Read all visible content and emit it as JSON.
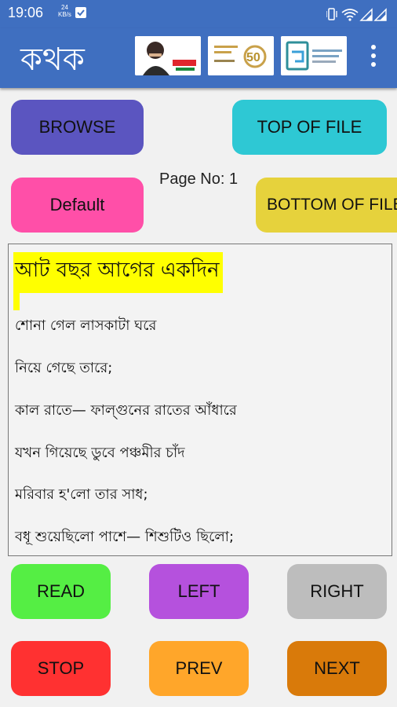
{
  "status_bar": {
    "time": "19:06",
    "network": "24 KB/s",
    "icons": [
      "notification-check-icon",
      "vibrate-icon",
      "wifi-icon",
      "signal-icon",
      "signal-2-icon"
    ]
  },
  "app_bar": {
    "title": "কথক",
    "logos": [
      "mujib-borsho-logo",
      "bangladesh-50-logo",
      "innovation-garage-logo"
    ],
    "menu_icon": "kebab-menu-icon"
  },
  "controls": {
    "browse": "BROWSE",
    "top_of_file": "TOP OF FILE",
    "default": "Default",
    "page_no": "Page No: 1",
    "bottom_of_file": "BOTTOM OF FILE"
  },
  "document": {
    "highlighted_line": "আট বছর আগের একদিন",
    "lines": [
      "শোনা গেল লাসকাটা ঘরে",
      "নিয়ে গেছে তারে;",
      "কাল রাতে— ফাল্গুনের রাতের আঁধারে",
      "যখন গিয়েছে ডুবে পঞ্চমীর চাঁদ",
      "মরিবার হ'লো তার সাধ;",
      "বধূ শুয়েছিলো পাশে— শিশুটিও ছিলো;"
    ]
  },
  "player": {
    "read": "READ",
    "left": "LEFT",
    "right": "RIGHT",
    "stop": "STOP",
    "prev": "PREV",
    "next": "NEXT"
  },
  "colors": {
    "app_bar": "#3f6fc0",
    "browse": "#5b55c0",
    "top_of_file": "#2ec8d4",
    "default": "#ff4fa8",
    "bottom_of_file": "#e6d23c",
    "highlight": "#ffff00",
    "read": "#55ee44",
    "left": "#b551dd",
    "right": "#bdbdbd",
    "stop": "#ff3131",
    "prev": "#ffa62a",
    "next": "#d97a0a"
  }
}
